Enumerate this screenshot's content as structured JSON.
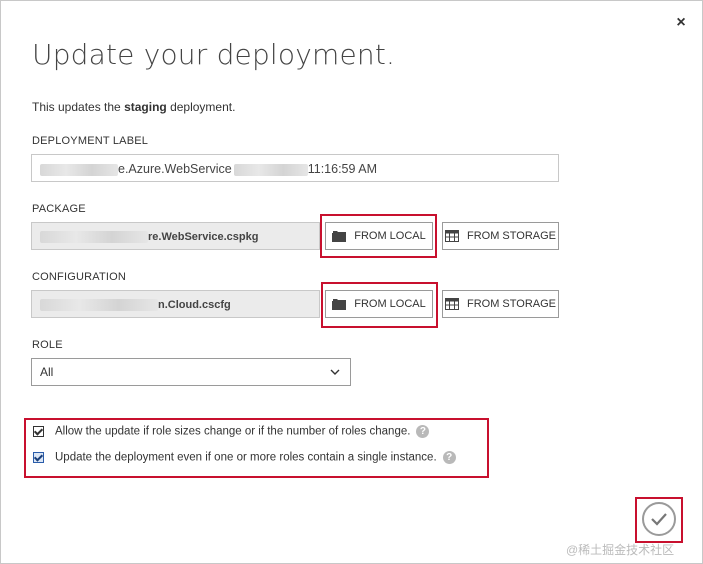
{
  "dialog": {
    "title": "Update your deployment.",
    "description_prefix": "This updates the ",
    "description_bold": "staging",
    "description_suffix": " deployment.",
    "close_glyph": "×"
  },
  "deployment_label": {
    "label": "DEPLOYMENT LABEL",
    "value_visible_middle": "e.Azure.WebService",
    "value_visible_end": "11:16:59 AM"
  },
  "package": {
    "label": "PACKAGE",
    "file_visible": "re.WebService.cspkg",
    "from_local": "FROM LOCAL",
    "from_storage": "FROM STORAGE"
  },
  "configuration": {
    "label": "CONFIGURATION",
    "file_visible": "n.Cloud.cscfg",
    "from_local": "FROM LOCAL",
    "from_storage": "FROM STORAGE"
  },
  "role": {
    "label": "ROLE",
    "selected": "All"
  },
  "options": {
    "allow_update": "Allow the update if role sizes change or if the number of roles change.",
    "single_instance": "Update the deployment even if one or more roles contain a single instance.",
    "help_glyph": "?"
  },
  "icons": {
    "folder": "folder-icon",
    "storage": "storage-grid-icon",
    "ok": "checkmark-icon"
  },
  "colors": {
    "highlight": "#c8102e",
    "file_field_bg": "#ebebeb"
  },
  "watermark": "@稀土掘金技术社区"
}
